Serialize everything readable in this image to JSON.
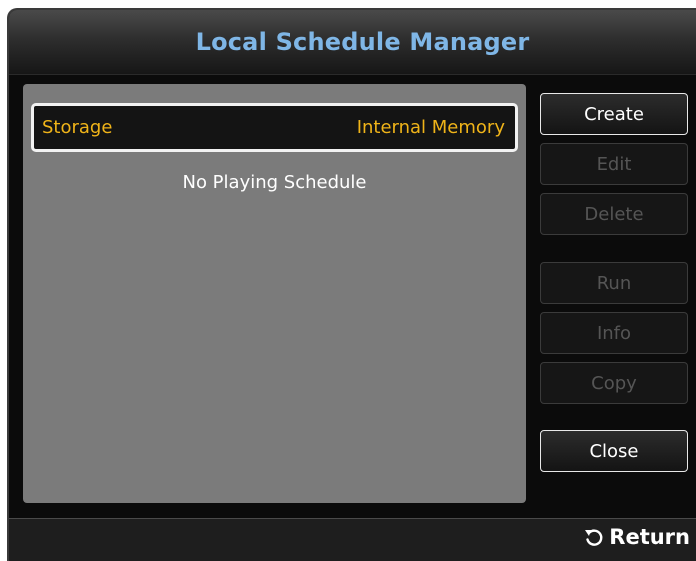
{
  "window": {
    "title": "Local Schedule Manager"
  },
  "storage": {
    "label": "Storage",
    "value": "Internal Memory"
  },
  "list": {
    "empty_message": "No Playing Schedule"
  },
  "buttons": {
    "create": "Create",
    "edit": "Edit",
    "delete": "Delete",
    "run": "Run",
    "info": "Info",
    "copy": "Copy",
    "close": "Close"
  },
  "footer": {
    "return_label": "Return",
    "return_icon": "return-arrow-icon"
  },
  "colors": {
    "title": "#7fb6e6",
    "highlight_text": "#f0b419",
    "panel": "#7b7b7b",
    "background": "#0b0b0b"
  }
}
